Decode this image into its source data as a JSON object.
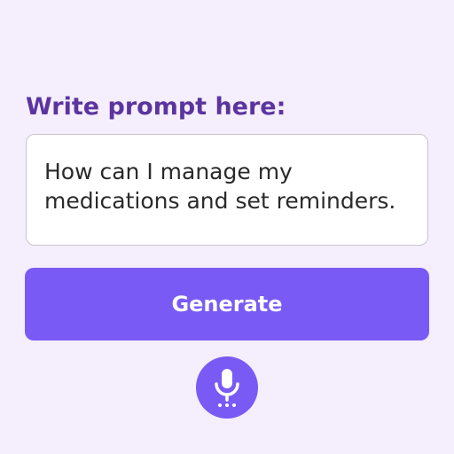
{
  "prompt": {
    "label": "Write prompt here:",
    "value": "How can I manage my\nmedications and set reminders."
  },
  "actions": {
    "generate_label": "Generate"
  },
  "voice_input": {
    "icon": "microphone-icon"
  },
  "colors": {
    "background": "#f5eefc",
    "label": "#5b34a0",
    "accent": "#7a5af5",
    "text": "#2a2a2a"
  }
}
